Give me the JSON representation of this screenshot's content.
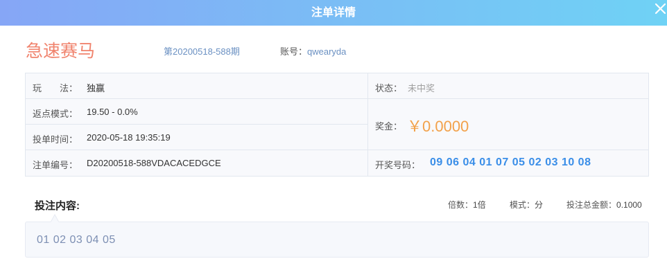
{
  "header": {
    "title": "注单详情",
    "close_icon": "close-icon"
  },
  "order": {
    "game_name": "急速赛马",
    "issue": "第20200518-588期",
    "account_label": "账号：",
    "account_value": "qwearyda"
  },
  "details": {
    "play_label": "玩　　法：",
    "play_value": "独赢",
    "rebate_label": "返点模式：",
    "rebate_value": "19.50 - 0.0%",
    "time_label": "投单时间：",
    "time_value": "2020-05-18 19:35:19",
    "order_no_label": "注单编号：",
    "order_no_value": "D20200518-588VDACACEDGCE",
    "status_label": "状态：",
    "status_value": "未中奖",
    "prize_label": "奖金：",
    "prize_value": "￥0.0000",
    "draw_label": "开奖号码：",
    "draw_value": "09 06 04 01 07 05 02 03 10 08"
  },
  "bet": {
    "heading": "投注内容:",
    "multiple_label": "倍数：",
    "multiple_value": "1倍",
    "mode_label": "模式：",
    "mode_value": "分",
    "total_label": "投注总金额：",
    "total_value": "0.1000",
    "content": "01 02 03 04 05"
  },
  "colors": {
    "header_gradient": [
      "#86a6f6",
      "#6fd2f5"
    ],
    "game_title": "#f0836d",
    "prize": "#f2a14a",
    "draw_numbers": "#3a8ee8",
    "link": "#6a90c2"
  }
}
